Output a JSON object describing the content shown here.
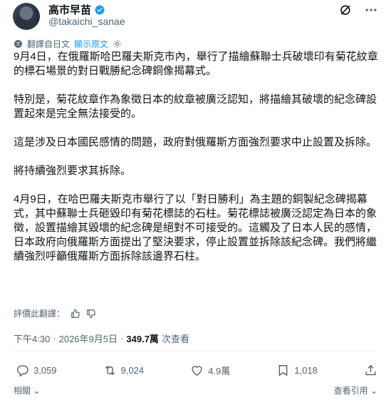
{
  "author": {
    "display_name": "高市早苗",
    "handle": "@takaichi_sanae",
    "avatar_icon": "avatar-photo",
    "verified_color": "#1d9bf0"
  },
  "header_icons": [
    "grok-icon",
    "more-icon"
  ],
  "translation": {
    "label": "翻譯自日文",
    "show_original": "顯示原文"
  },
  "body": {
    "paragraphs": [
      "9月4日，在俄羅斯哈巴羅夫斯克市內，舉行了描繪蘇聯士兵破壞印有菊花紋章的標石場景的對日戰勝紀念碑銅像揭幕式。",
      "特別是，菊花紋章作為象徵日本的紋章被廣泛認知，將描繪其破壞的紀念碑設置起來是完全無法接受的。",
      "這是涉及日本國民感情的問題，政府對俄羅斯方面強烈要求中止設置及拆除。",
      "將持續強烈要求其拆除。",
      "4月9日，在哈巴羅夫斯克市舉行了以「對日勝利」為主題的銅製紀念碑揭幕式，其中蘇聯士兵砸毀印有菊花標誌的石柱。菊花標誌被廣泛認定為日本的象徵，設置描繪其毀壞的紀念碑是絕對不可接受的。這觸及了日本人民的感情，日本政府向俄羅斯方面提出了堅決要求，停止設置並拆除該紀念碑。我們將繼續強烈呼籲俄羅斯方面拆除該邊界石柱。"
    ]
  },
  "rate_translation": "評價此翻譯：",
  "meta": {
    "time": "下午4:30",
    "date": "2026年9月5日",
    "separator": "·",
    "views_count": "349.7萬",
    "views_label": "次查看"
  },
  "actions": {
    "replies": "3,059",
    "reposts": "9,024",
    "likes": "4.9萬",
    "bookmarks": "1,018"
  },
  "footer": {
    "related": "相關",
    "view_quotes": "查看引用"
  },
  "colors": {
    "text": "#0f1419",
    "secondary": "#536471",
    "accent": "#1d9bf0"
  }
}
